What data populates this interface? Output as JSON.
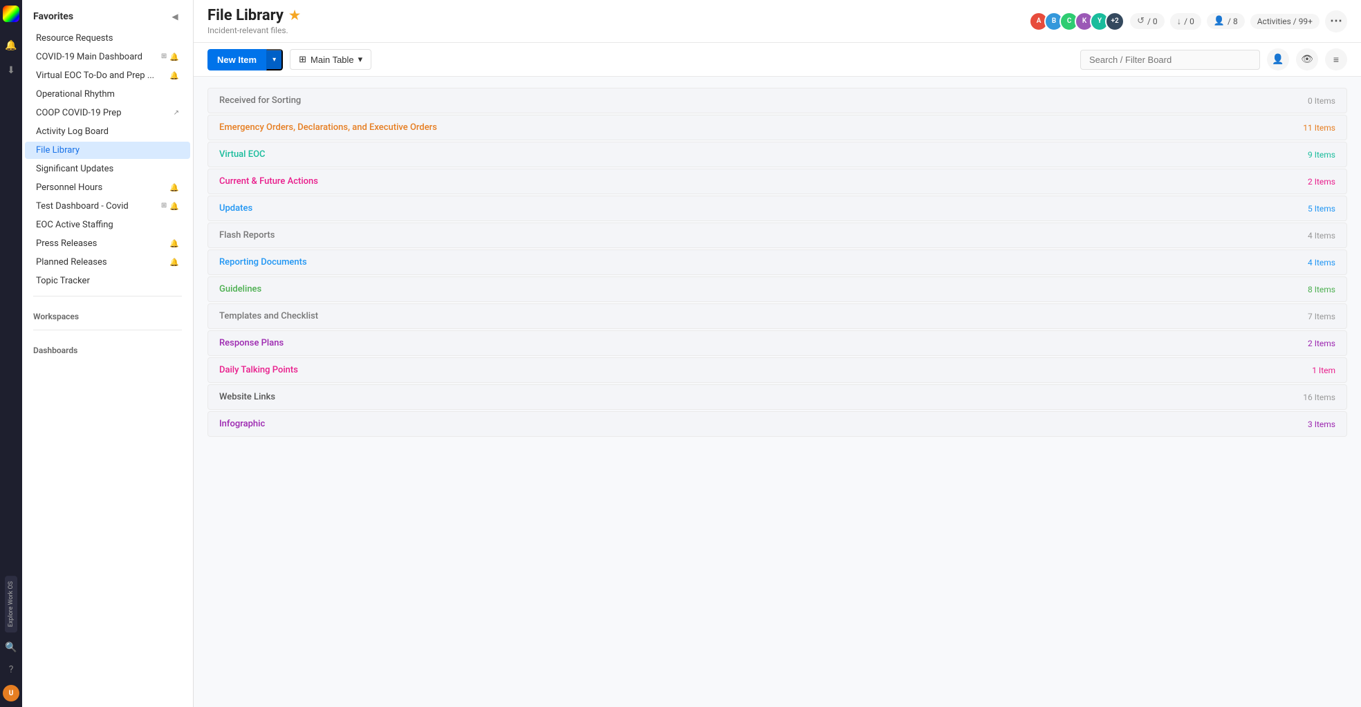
{
  "app": {
    "logo": "monday-logo"
  },
  "nav_rail": {
    "icons": [
      {
        "name": "bell-icon",
        "symbol": "🔔",
        "active": false
      },
      {
        "name": "download-icon",
        "symbol": "⬇",
        "active": false
      }
    ],
    "explore_label": "Explore Work OS",
    "avatar_initials": "U"
  },
  "sidebar": {
    "favorites_title": "Favorites",
    "items": [
      {
        "id": "resource-requests",
        "label": "Resource Requests",
        "icons": [],
        "active": false
      },
      {
        "id": "covid-main-dashboard",
        "label": "COVID-19 Main Dashboard",
        "icons": [
          "grid",
          "bell-red"
        ],
        "active": false
      },
      {
        "id": "virtual-eoc",
        "label": "Virtual EOC To-Do and Prep ...",
        "icons": [
          "bell-red"
        ],
        "active": false
      },
      {
        "id": "operational-rhythm",
        "label": "Operational Rhythm",
        "icons": [],
        "active": false
      },
      {
        "id": "coop-covid",
        "label": "COOP COVID-19 Prep",
        "icons": [
          "share"
        ],
        "active": false
      },
      {
        "id": "activity-log-board",
        "label": "Activity Log Board",
        "icons": [],
        "active": false
      },
      {
        "id": "file-library",
        "label": "File Library",
        "icons": [],
        "active": true
      },
      {
        "id": "significant-updates",
        "label": "Significant Updates",
        "icons": [],
        "active": false
      },
      {
        "id": "personnel-hours",
        "label": "Personnel Hours",
        "icons": [
          "bell-red"
        ],
        "active": false
      },
      {
        "id": "test-dashboard",
        "label": "Test Dashboard - Covid",
        "icons": [
          "grid",
          "bell-red"
        ],
        "active": false
      },
      {
        "id": "eoc-active-staffing",
        "label": "EOC Active Staffing",
        "icons": [],
        "active": false
      },
      {
        "id": "press-releases",
        "label": "Press Releases",
        "icons": [
          "bell-red"
        ],
        "active": false
      },
      {
        "id": "planned-releases",
        "label": "Planned Releases",
        "icons": [
          "bell-red"
        ],
        "active": false
      },
      {
        "id": "topic-tracker",
        "label": "Topic Tracker",
        "icons": [],
        "active": false
      }
    ],
    "workspaces_title": "Workspaces",
    "dashboards_title": "Dashboards"
  },
  "topbar": {
    "title": "File Library",
    "star": "★",
    "subtitle": "Incident-relevant files.",
    "avatars": [
      {
        "color": "#e74c3c",
        "initials": "A"
      },
      {
        "color": "#3498db",
        "initials": "B"
      },
      {
        "color": "#2ecc71",
        "initials": "C"
      },
      {
        "color": "#9b59b6",
        "initials": "K"
      },
      {
        "color": "#1abc9c",
        "initials": "Y"
      },
      {
        "color": "#34495e",
        "initials": "+2"
      }
    ],
    "stats": [
      {
        "icon": "↺",
        "value": "/ 0",
        "name": "refresh-stat"
      },
      {
        "icon": "↓",
        "value": "/ 0",
        "name": "download-stat"
      },
      {
        "icon": "👤",
        "value": "/ 8",
        "name": "user-stat"
      }
    ],
    "activities_label": "Activities / 99+"
  },
  "toolbar": {
    "new_item_label": "New Item",
    "new_item_dropdown": "▾",
    "table_view_label": "Main Table",
    "table_view_icon": "⊞",
    "search_placeholder": "Search / Filter Board",
    "person_icon": "👤",
    "eye_icon": "👁",
    "filter_icon": "≡"
  },
  "groups": [
    {
      "id": "received-sorting",
      "label": "Received for Sorting",
      "count": "0 Items",
      "color": "gray"
    },
    {
      "id": "emergency-orders",
      "label": "Emergency Orders, Declarations, and Executive Orders",
      "count": "11 Items",
      "color": "orange"
    },
    {
      "id": "virtual-eoc",
      "label": "Virtual EOC",
      "count": "9 Items",
      "color": "teal"
    },
    {
      "id": "current-future-actions",
      "label": "Current & Future Actions",
      "count": "2 Items",
      "color": "pink"
    },
    {
      "id": "updates",
      "label": "Updates",
      "count": "5 Items",
      "color": "blue"
    },
    {
      "id": "flash-reports",
      "label": "Flash Reports",
      "count": "4 Items",
      "color": "gray"
    },
    {
      "id": "reporting-documents",
      "label": "Reporting Documents",
      "count": "4 Items",
      "color": "blue"
    },
    {
      "id": "guidelines",
      "label": "Guidelines",
      "count": "8 Items",
      "color": "green"
    },
    {
      "id": "templates-checklist",
      "label": "Templates and Checklist",
      "count": "7 Items",
      "color": "gray"
    },
    {
      "id": "response-plans",
      "label": "Response Plans",
      "count": "2 Items",
      "color": "purple"
    },
    {
      "id": "daily-talking-points",
      "label": "Daily Talking Points",
      "count": "1 Item",
      "color": "pink"
    },
    {
      "id": "website-links",
      "label": "Website Links",
      "count": "16 Items",
      "color": "dark-gray"
    },
    {
      "id": "infographic",
      "label": "Infographic",
      "count": "3 Items",
      "color": "purple"
    }
  ]
}
